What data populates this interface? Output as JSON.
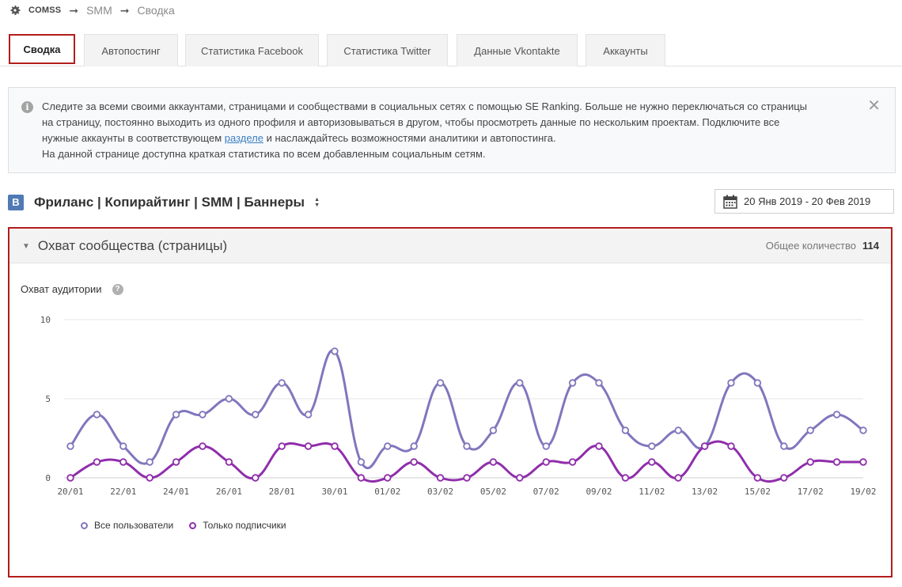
{
  "breadcrumb": {
    "root": "COMSS",
    "items": [
      "SMM",
      "Сводка"
    ]
  },
  "tabs": [
    {
      "label": "Сводка",
      "active": true
    },
    {
      "label": "Автопостинг"
    },
    {
      "label": "Статистика Facebook"
    },
    {
      "label": "Статистика Twitter"
    },
    {
      "label": "Данные Vkontakte"
    },
    {
      "label": "Аккаунты"
    }
  ],
  "alert": {
    "line1": "Следите за всеми своими аккаунтами, страницами и сообществами в социальных сетях с помощью SE Ranking. Больше не нужно переключаться со страницы",
    "line2": "на страницу, постоянно выходить из одного профиля и авторизовываться в другом, чтобы просмотреть данные по нескольким проектам. Подключите все",
    "line3_before": "нужные аккаунты в соответствующем ",
    "line3_link": "разделе",
    "line3_after": " и наслаждайтесь возможностями аналитики и автопостинга.",
    "line4": "На данной странице доступна краткая статистика по всем добавленным социальным сетям."
  },
  "project": {
    "badge": "В",
    "name": "Фриланс | Копирайтинг | SMM | Баннеры"
  },
  "date_range": "20 Янв 2019 - 20 Фев 2019",
  "panel": {
    "title": "Охват сообщества (страницы)",
    "total_label": "Общее количество",
    "total_value": "114",
    "metric_title": "Охват аудитории",
    "help": "?"
  },
  "colors": {
    "accent": "#b41c1c",
    "series_all": "#8077bd",
    "series_subs": "#8f2eab"
  },
  "chart_data": {
    "type": "line",
    "ylim": [
      0,
      10
    ],
    "yticks": [
      0,
      5,
      10
    ],
    "x": [
      "20/01",
      "21/01",
      "22/01",
      "23/01",
      "24/01",
      "25/01",
      "26/01",
      "27/01",
      "28/01",
      "29/01",
      "30/01",
      "31/01",
      "01/02",
      "02/02",
      "03/02",
      "04/02",
      "05/02",
      "06/02",
      "07/02",
      "08/02",
      "09/02",
      "10/02",
      "11/02",
      "12/02",
      "13/02",
      "14/02",
      "15/02",
      "16/02",
      "17/02",
      "18/02",
      "19/02"
    ],
    "xtick_labels": [
      "20/01",
      "22/01",
      "24/01",
      "26/01",
      "28/01",
      "30/01",
      "01/02",
      "03/02",
      "05/02",
      "07/02",
      "09/02",
      "11/02",
      "13/02",
      "15/02",
      "17/02",
      "19/02"
    ],
    "series": [
      {
        "name": "Все пользователи",
        "values": [
          2,
          4,
          2,
          1,
          4,
          4,
          5,
          4,
          6,
          4,
          8,
          1,
          2,
          2,
          6,
          2,
          3,
          6,
          2,
          6,
          6,
          3,
          2,
          3,
          2,
          6,
          6,
          2,
          3,
          4,
          3
        ]
      },
      {
        "name": "Только подписчики",
        "values": [
          0,
          1,
          1,
          0,
          1,
          2,
          1,
          0,
          2,
          2,
          2,
          0,
          0,
          1,
          0,
          0,
          1,
          0,
          1,
          1,
          2,
          0,
          1,
          0,
          2,
          2,
          0,
          0,
          1,
          1,
          1
        ]
      }
    ]
  }
}
